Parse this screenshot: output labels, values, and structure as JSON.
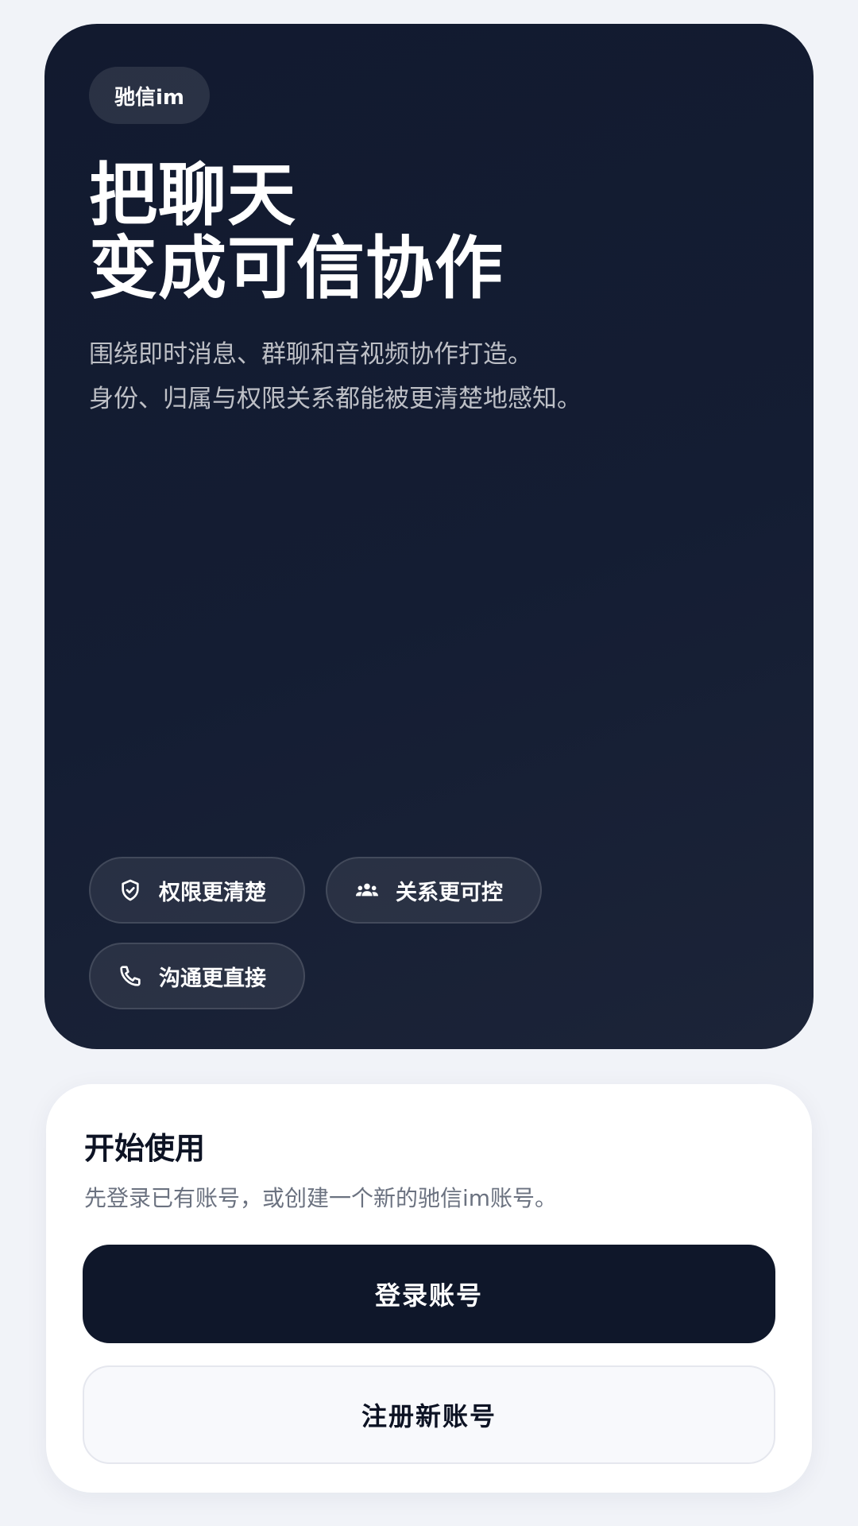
{
  "hero": {
    "brand": "驰信im",
    "headline": [
      "把聊天",
      "变成可信协作"
    ],
    "subtitle": [
      "围绕即时消息、群聊和音视频协作打造。",
      "身份、归属与权限关系都能被更清楚地感知。"
    ],
    "chips": [
      {
        "icon": "shield-icon",
        "label": "权限更清楚"
      },
      {
        "icon": "group-icon",
        "label": "关系更可控"
      },
      {
        "icon": "phone-icon",
        "label": "沟通更直接"
      }
    ]
  },
  "start": {
    "title": "开始使用",
    "description": "先登录已有账号，或创建一个新的驰信im账号。",
    "login_label": "登录账号",
    "register_label": "注册新账号"
  },
  "colors": {
    "hero_bg": "#121a2f",
    "primary_button": "#0f172a",
    "page_bg": "#f1f3f8"
  }
}
